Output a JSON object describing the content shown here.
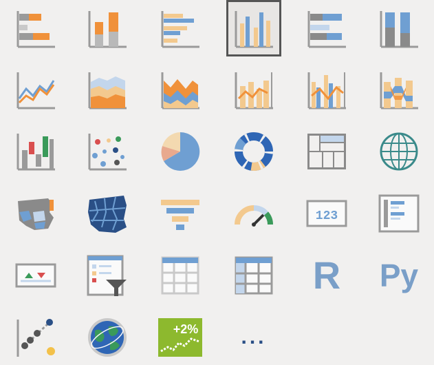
{
  "visualizations": [
    {
      "name": "Stacked bar chart",
      "icon": "stacked-bar-chart-icon"
    },
    {
      "name": "Stacked column chart",
      "icon": "stacked-column-chart-icon"
    },
    {
      "name": "Clustered bar chart",
      "icon": "clustered-bar-chart-icon"
    },
    {
      "name": "Clustered column chart",
      "icon": "clustered-column-chart-icon",
      "selected": true
    },
    {
      "name": "100% stacked bar chart",
      "icon": "percent-stacked-bar-chart-icon"
    },
    {
      "name": "100% stacked column chart",
      "icon": "percent-stacked-column-chart-icon"
    },
    {
      "name": "Line chart",
      "icon": "line-chart-icon"
    },
    {
      "name": "Area chart",
      "icon": "area-chart-icon"
    },
    {
      "name": "Stacked area chart",
      "icon": "stacked-area-chart-icon"
    },
    {
      "name": "Line and stacked column chart",
      "icon": "line-stacked-column-chart-icon"
    },
    {
      "name": "Line and clustered column chart",
      "icon": "line-clustered-column-chart-icon"
    },
    {
      "name": "Ribbon chart",
      "icon": "ribbon-chart-icon"
    },
    {
      "name": "Waterfall chart",
      "icon": "waterfall-chart-icon"
    },
    {
      "name": "Scatter chart",
      "icon": "scatter-chart-icon"
    },
    {
      "name": "Pie chart",
      "icon": "pie-chart-icon"
    },
    {
      "name": "Donut chart",
      "icon": "donut-chart-icon"
    },
    {
      "name": "Treemap",
      "icon": "treemap-icon"
    },
    {
      "name": "Map",
      "icon": "globe-map-icon"
    },
    {
      "name": "Filled map",
      "icon": "filled-map-icon"
    },
    {
      "name": "Shape map",
      "icon": "shape-map-icon"
    },
    {
      "name": "Funnel",
      "icon": "funnel-icon"
    },
    {
      "name": "Gauge",
      "icon": "gauge-icon"
    },
    {
      "name": "Card",
      "icon": "card-icon",
      "text": "123"
    },
    {
      "name": "Multi-row card",
      "icon": "multi-row-card-icon"
    },
    {
      "name": "KPI",
      "icon": "kpi-icon"
    },
    {
      "name": "Slicer",
      "icon": "slicer-icon"
    },
    {
      "name": "Table",
      "icon": "table-icon"
    },
    {
      "name": "Matrix",
      "icon": "matrix-icon"
    },
    {
      "name": "R script visual",
      "icon": "r-script-icon",
      "text": "R"
    },
    {
      "name": "Python visual",
      "icon": "python-visual-icon",
      "text": "Py"
    },
    {
      "name": "Key influencers",
      "icon": "key-influencers-icon"
    },
    {
      "name": "ArcGIS Maps",
      "icon": "arcgis-globe-icon"
    },
    {
      "name": "Custom KPI visual",
      "icon": "custom-kpi-icon",
      "text": "+2%"
    },
    {
      "name": "More visuals",
      "icon": "ellipsis-icon",
      "text": "..."
    }
  ],
  "colors": {
    "orange": "#f0913a",
    "blue": "#6f9fd2",
    "lightOrange": "#f3c98e",
    "gray": "#8a8a8a",
    "axis": "#9a9a9a",
    "navy": "#2a4f86",
    "green": "#8db92e"
  }
}
